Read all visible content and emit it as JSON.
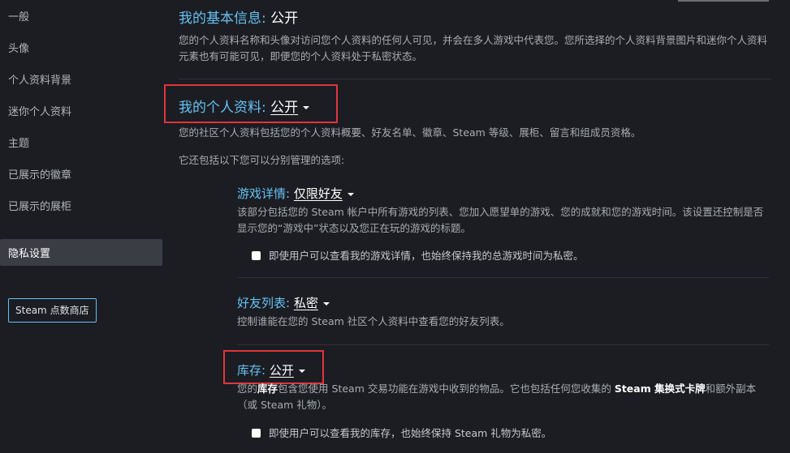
{
  "sidebar": {
    "items": [
      "一般",
      "头像",
      "个人资料背景",
      "迷你个人资料",
      "主题",
      "已展示的徽章",
      "已展示的展柜"
    ],
    "active": "隐私设置",
    "store_button": "Steam 点数商店"
  },
  "basic_info": {
    "label": "我的基本信息:",
    "value": "公开",
    "desc": "您的个人资料名称和头像对访问您个人资料的任何人可见，并会在多人游戏中代表您。您所选择的个人资料背景图片和迷你个人资料元素也有可能可见，即便您的个人资料处于私密状态。"
  },
  "profile": {
    "label": "我的个人资料:",
    "value": "公开",
    "desc": "您的社区个人资料包括您的个人资料概要、好友名单、徽章、Steam 等级、展柜、留言和组成员资格。",
    "desc2": "它还包括以下您可以分别管理的选项:"
  },
  "game_details": {
    "label": "游戏详情:",
    "value": "仅限好友",
    "desc": "该部分包括您的 Steam 帐户中所有游戏的列表、您加入愿望单的游戏、您的成就和您的游戏时间。该设置还控制是否显示您的“游戏中”状态以及您正在玩的游戏的标题。",
    "checkbox": "即使用户可以查看我的游戏详情，也始终保持我的总游戏时间为私密。"
  },
  "friends_list": {
    "label": "好友列表:",
    "value": "私密",
    "desc": "控制谁能在您的 Steam 社区个人资料中查看您的好友列表。"
  },
  "inventory": {
    "label": "库存:",
    "value": "公开",
    "desc_a": "您的",
    "desc_b": "库存",
    "desc_c": "包含您使用 Steam 交易功能在游戏中收到的物品。它也包括任何您收集的 ",
    "desc_d": "Steam 集换式卡牌",
    "desc_e": "和额外副本（或 Steam 礼物）。",
    "checkbox": "即使用户可以查看我的库存，也始终保持 Steam 礼物为私密。"
  }
}
